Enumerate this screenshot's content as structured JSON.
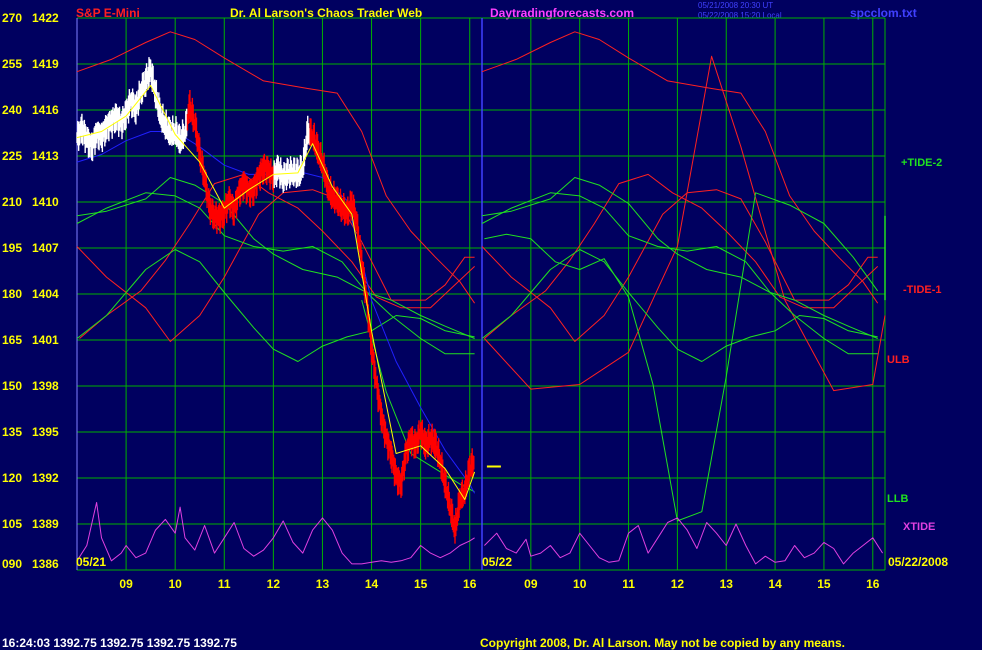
{
  "header": {
    "instrument": "S&P E-Mini",
    "title": "Dr. Al Larson's Chaos Trader Web",
    "site": "Daytradingforecasts.com",
    "timestamp_line1": "05/21/2008 20:30 UT",
    "timestamp_line2": "05/22/2008 15:20 Local",
    "filename": "spcclom.txt"
  },
  "footer": {
    "quote": "16:24:03  1392.75  1392.75  1392.75  1392.75",
    "copyright": "Copyright 2008, Dr. Al Larson. May not be copied by any means."
  },
  "colors": {
    "background": "#000060",
    "grid": "#00b000",
    "price_up": "#ffffff",
    "price_down": "#ff0000",
    "red_curves": "#ff2020",
    "green_curves": "#20e020",
    "blue_line": "#2020ff",
    "yellow_line": "#ffff00",
    "xtide": "#e040e0",
    "labels": "#ffff00",
    "site": "#ff40ff"
  },
  "chart_data": {
    "type": "line",
    "y_axis": {
      "ticks": [
        {
          "index": "270",
          "price": "1422"
        },
        {
          "index": "255",
          "price": "1419"
        },
        {
          "index": "240",
          "price": "1416"
        },
        {
          "index": "225",
          "price": "1413"
        },
        {
          "index": "210",
          "price": "1410"
        },
        {
          "index": "195",
          "price": "1407"
        },
        {
          "index": "180",
          "price": "1404"
        },
        {
          "index": "165",
          "price": "1401"
        },
        {
          "index": "150",
          "price": "1398"
        },
        {
          "index": "135",
          "price": "1395"
        },
        {
          "index": "120",
          "price": "1392"
        },
        {
          "index": "105",
          "price": "1389"
        },
        {
          "index": "090",
          "price": "1386"
        }
      ],
      "range": [
        1386,
        1422
      ]
    },
    "x_axis": {
      "day1_label": "05/21",
      "day2_label": "05/22",
      "date_right": "05/22/2008",
      "ticks_day1": [
        "09",
        "10",
        "11",
        "12",
        "13",
        "14",
        "15",
        "16"
      ],
      "ticks_day2": [
        "09",
        "10",
        "11",
        "12",
        "13",
        "14",
        "15",
        "16"
      ],
      "range_hours": [
        8.0,
        16.25
      ]
    },
    "series_labels": [
      {
        "name": "+TIDE-2",
        "color": "#20e020"
      },
      {
        "name": "-TIDE-1",
        "color": "#ff2020"
      },
      {
        "name": "ULB",
        "color": "#ff2020"
      },
      {
        "name": "LLB",
        "color": "#20e020"
      },
      {
        "name": "XTIDE",
        "color": "#e040e0"
      }
    ],
    "price_bars": [
      [
        8.0,
        1414.2
      ],
      [
        8.1,
        1414.8
      ],
      [
        8.2,
        1414.1
      ],
      [
        8.3,
        1413.6
      ],
      [
        8.4,
        1414.5
      ],
      [
        8.5,
        1414.3
      ],
      [
        8.6,
        1414.9
      ],
      [
        8.7,
        1415.2
      ],
      [
        8.8,
        1415.6
      ],
      [
        8.9,
        1415.1
      ],
      [
        9.0,
        1415.8
      ],
      [
        9.1,
        1416.6
      ],
      [
        9.2,
        1416.1
      ],
      [
        9.3,
        1417.2
      ],
      [
        9.4,
        1417.9
      ],
      [
        9.5,
        1418.6
      ],
      [
        9.6,
        1417.1
      ],
      [
        9.7,
        1415.6
      ],
      [
        9.8,
        1415.0
      ],
      [
        9.9,
        1414.4
      ],
      [
        10.0,
        1414.6
      ],
      [
        10.1,
        1413.9
      ],
      [
        10.2,
        1414.6
      ],
      [
        10.3,
        1416.2
      ],
      [
        10.4,
        1415.2
      ],
      [
        10.5,
        1413.1
      ],
      [
        10.6,
        1411.6
      ],
      [
        10.7,
        1409.6
      ],
      [
        10.8,
        1409.1
      ],
      [
        10.9,
        1408.9
      ],
      [
        11.0,
        1409.4
      ],
      [
        11.1,
        1410.1
      ],
      [
        11.2,
        1409.5
      ],
      [
        11.3,
        1410.6
      ],
      [
        11.4,
        1411.3
      ],
      [
        11.5,
        1410.6
      ],
      [
        11.6,
        1410.9
      ],
      [
        11.7,
        1411.6
      ],
      [
        11.8,
        1412.3
      ],
      [
        11.9,
        1412.0
      ],
      [
        12.0,
        1411.7
      ],
      [
        12.1,
        1412.1
      ],
      [
        12.2,
        1411.6
      ],
      [
        12.3,
        1411.8
      ],
      [
        12.4,
        1412.0
      ],
      [
        12.5,
        1411.7
      ],
      [
        12.6,
        1412.3
      ],
      [
        12.7,
        1414.5
      ],
      [
        12.8,
        1414.4
      ],
      [
        12.9,
        1413.3
      ],
      [
        13.0,
        1412.6
      ],
      [
        13.1,
        1411.0
      ],
      [
        13.2,
        1410.4
      ],
      [
        13.3,
        1410.0
      ],
      [
        13.4,
        1409.7
      ],
      [
        13.5,
        1409.2
      ],
      [
        13.6,
        1410.0
      ],
      [
        13.7,
        1408.6
      ],
      [
        13.8,
        1406.1
      ],
      [
        13.9,
        1403.6
      ],
      [
        14.0,
        1400.6
      ],
      [
        14.1,
        1398.1
      ],
      [
        14.2,
        1396.1
      ],
      [
        14.3,
        1394.6
      ],
      [
        14.4,
        1393.6
      ],
      [
        14.5,
        1392.1
      ],
      [
        14.6,
        1391.6
      ],
      [
        14.7,
        1393.6
      ],
      [
        14.8,
        1394.6
      ],
      [
        14.9,
        1394.1
      ],
      [
        15.0,
        1395.1
      ],
      [
        15.1,
        1394.1
      ],
      [
        15.2,
        1394.6
      ],
      [
        15.3,
        1394.2
      ],
      [
        15.4,
        1393.1
      ],
      [
        15.5,
        1391.6
      ],
      [
        15.6,
        1390.1
      ],
      [
        15.7,
        1388.6
      ],
      [
        15.8,
        1390.6
      ],
      [
        15.9,
        1391.1
      ],
      [
        16.0,
        1392.6
      ],
      [
        16.1,
        1393.1
      ]
    ],
    "projection_mark": {
      "hour": 16.35,
      "price": 1392.75
    },
    "red_curves": [
      [
        [
          8.0,
          1418.5
        ],
        [
          8.7,
          1419.3
        ],
        [
          9.4,
          1420.4
        ],
        [
          9.9,
          1421.1
        ],
        [
          10.4,
          1420.6
        ],
        [
          11.0,
          1419.4
        ],
        [
          11.8,
          1417.9
        ],
        [
          12.7,
          1417.4
        ],
        [
          13.3,
          1417.1
        ],
        [
          13.8,
          1414.6
        ],
        [
          14.3,
          1410.4
        ],
        [
          14.8,
          1408.1
        ],
        [
          15.3,
          1406.4
        ],
        [
          15.8,
          1404.8
        ],
        [
          16.1,
          1403.4
        ]
      ],
      [
        [
          8.0,
          1407.1
        ],
        [
          8.6,
          1405.1
        ],
        [
          9.4,
          1403.1
        ],
        [
          9.9,
          1400.9
        ],
        [
          10.5,
          1402.6
        ],
        [
          11.0,
          1405.1
        ],
        [
          11.7,
          1409.2
        ],
        [
          12.2,
          1410.6
        ],
        [
          12.8,
          1410.8
        ],
        [
          13.3,
          1410.2
        ],
        [
          13.8,
          1407.4
        ],
        [
          14.4,
          1403.6
        ],
        [
          15.1,
          1403.6
        ],
        [
          15.5,
          1404.6
        ],
        [
          15.9,
          1406.4
        ],
        [
          16.1,
          1406.4
        ]
      ],
      [
        [
          8.05,
          1401.1
        ],
        [
          8.6,
          1402.6
        ],
        [
          9.3,
          1404.2
        ],
        [
          9.8,
          1406.2
        ],
        [
          10.3,
          1408.6
        ],
        [
          10.8,
          1411.2
        ],
        [
          11.4,
          1411.8
        ],
        [
          11.9,
          1410.6
        ],
        [
          12.5,
          1409.6
        ],
        [
          13.0,
          1408.1
        ],
        [
          13.6,
          1406.1
        ],
        [
          14.1,
          1403.8
        ],
        [
          14.6,
          1403.1
        ],
        [
          15.2,
          1403.1
        ],
        [
          15.7,
          1404.6
        ],
        [
          16.1,
          1405.8
        ]
      ],
      [
        [
          8.05,
          1401.1
        ],
        [
          9.0,
          1397.8
        ],
        [
          10.0,
          1398.1
        ],
        [
          11.0,
          1400.2
        ],
        [
          12.0,
          1407.1
        ],
        [
          12.7,
          1419.5
        ],
        [
          13.3,
          1413.6
        ],
        [
          14.2,
          1403.6
        ],
        [
          15.2,
          1397.7
        ],
        [
          16.0,
          1398.1
        ],
        [
          16.25,
          1402.6
        ]
      ]
    ],
    "green_curves": [
      [
        [
          8.0,
          1401.1
        ],
        [
          8.6,
          1402.6
        ],
        [
          9.4,
          1405.6
        ],
        [
          10.0,
          1406.9
        ],
        [
          10.5,
          1406.1
        ],
        [
          11.0,
          1404.1
        ],
        [
          11.6,
          1401.8
        ],
        [
          12.0,
          1400.4
        ],
        [
          12.5,
          1399.6
        ],
        [
          13.0,
          1400.6
        ],
        [
          13.5,
          1401.2
        ],
        [
          14.0,
          1401.6
        ],
        [
          14.5,
          1402.6
        ],
        [
          15.0,
          1402.4
        ],
        [
          15.5,
          1401.6
        ],
        [
          16.1,
          1401.2
        ]
      ],
      [
        [
          8.0,
          1408.6
        ],
        [
          8.6,
          1409.6
        ],
        [
          9.4,
          1410.6
        ],
        [
          10.0,
          1410.4
        ],
        [
          10.5,
          1409.6
        ],
        [
          11.0,
          1407.8
        ],
        [
          11.6,
          1407.1
        ],
        [
          12.2,
          1406.8
        ],
        [
          12.8,
          1407.1
        ],
        [
          13.4,
          1406.1
        ],
        [
          13.9,
          1404.1
        ],
        [
          14.4,
          1403.6
        ],
        [
          15.0,
          1402.6
        ],
        [
          15.5,
          1401.9
        ],
        [
          16.1,
          1401.1
        ]
      ],
      [
        [
          8.0,
          1409.1
        ],
        [
          8.6,
          1409.4
        ],
        [
          9.4,
          1410.2
        ],
        [
          9.9,
          1411.6
        ],
        [
          10.4,
          1411.1
        ],
        [
          11.0,
          1409.9
        ],
        [
          11.6,
          1407.6
        ],
        [
          12.0,
          1406.6
        ],
        [
          12.6,
          1405.6
        ],
        [
          13.3,
          1405.1
        ],
        [
          13.9,
          1404.1
        ],
        [
          14.4,
          1402.6
        ],
        [
          15.0,
          1401.1
        ],
        [
          15.5,
          1400.1
        ],
        [
          16.1,
          1400.1
        ]
      ],
      [
        [
          8.05,
          1407.6
        ],
        [
          8.5,
          1407.9
        ],
        [
          9.0,
          1407.6
        ],
        [
          9.5,
          1406.1
        ],
        [
          10.0,
          1405.6
        ],
        [
          10.5,
          1406.3
        ],
        [
          11.0,
          1403.8
        ],
        [
          11.5,
          1398.1
        ],
        [
          12.0,
          1389.2
        ],
        [
          12.5,
          1389.8
        ],
        [
          13.0,
          1398.6
        ],
        [
          13.6,
          1410.6
        ],
        [
          14.3,
          1409.8
        ],
        [
          15.0,
          1408.6
        ],
        [
          15.6,
          1406.4
        ],
        [
          16.1,
          1404.2
        ]
      ],
      [
        [
          13.8,
          1403.6
        ],
        [
          14.3,
          1397.6
        ],
        [
          14.8,
          1393.6
        ],
        [
          15.3,
          1392.6
        ],
        [
          15.8,
          1391.6
        ],
        [
          16.1,
          1391.1
        ]
      ]
    ],
    "blue_line": [
      [
        8.0,
        1412.6
      ],
      [
        8.5,
        1413.1
      ],
      [
        9.0,
        1414.0
      ],
      [
        9.5,
        1414.6
      ],
      [
        10.0,
        1414.6
      ],
      [
        10.5,
        1413.6
      ],
      [
        11.0,
        1412.4
      ],
      [
        11.5,
        1411.8
      ],
      [
        12.0,
        1411.8
      ],
      [
        12.5,
        1412.0
      ],
      [
        13.0,
        1411.6
      ],
      [
        13.5,
        1410.1
      ],
      [
        14.0,
        1403.6
      ],
      [
        14.5,
        1399.6
      ],
      [
        15.0,
        1396.6
      ],
      [
        15.5,
        1393.8
      ],
      [
        16.0,
        1391.6
      ],
      [
        16.1,
        1391.0
      ]
    ],
    "yellow_line": [
      [
        8.0,
        1414.2
      ],
      [
        8.5,
        1414.6
      ],
      [
        9.0,
        1415.6
      ],
      [
        9.5,
        1417.6
      ],
      [
        10.0,
        1414.4
      ],
      [
        10.5,
        1412.6
      ],
      [
        11.0,
        1409.6
      ],
      [
        11.5,
        1410.8
      ],
      [
        12.0,
        1411.8
      ],
      [
        12.5,
        1411.9
      ],
      [
        12.8,
        1413.8
      ],
      [
        13.2,
        1411.0
      ],
      [
        13.6,
        1409.2
      ],
      [
        14.0,
        1401.6
      ],
      [
        14.5,
        1393.6
      ],
      [
        15.0,
        1394.1
      ],
      [
        15.5,
        1392.6
      ],
      [
        15.9,
        1390.6
      ],
      [
        16.1,
        1392.4
      ]
    ],
    "xtide_day1": [
      [
        8.0,
        1386.6
      ],
      [
        8.2,
        1387.6
      ],
      [
        8.4,
        1390.4
      ],
      [
        8.5,
        1388.1
      ],
      [
        8.7,
        1386.6
      ],
      [
        8.9,
        1387.1
      ],
      [
        9.0,
        1387.6
      ],
      [
        9.2,
        1386.8
      ],
      [
        9.4,
        1387.1
      ],
      [
        9.6,
        1388.6
      ],
      [
        9.8,
        1389.3
      ],
      [
        10.0,
        1388.4
      ],
      [
        10.1,
        1390.1
      ],
      [
        10.2,
        1388.1
      ],
      [
        10.4,
        1387.3
      ],
      [
        10.6,
        1388.9
      ],
      [
        10.8,
        1387.1
      ],
      [
        11.0,
        1388.1
      ],
      [
        11.2,
        1389.1
      ],
      [
        11.4,
        1387.4
      ],
      [
        11.6,
        1386.9
      ],
      [
        11.8,
        1387.3
      ],
      [
        12.0,
        1388.1
      ],
      [
        12.2,
        1389.2
      ],
      [
        12.4,
        1387.8
      ],
      [
        12.6,
        1387.1
      ],
      [
        12.8,
        1388.6
      ],
      [
        13.0,
        1389.4
      ],
      [
        13.2,
        1388.6
      ],
      [
        13.4,
        1387.1
      ],
      [
        13.6,
        1386.4
      ],
      [
        13.8,
        1386.4
      ],
      [
        14.0,
        1386.5
      ],
      [
        14.2,
        1386.6
      ],
      [
        14.4,
        1386.5
      ],
      [
        14.6,
        1386.6
      ],
      [
        14.8,
        1386.8
      ],
      [
        15.0,
        1387.6
      ],
      [
        15.2,
        1387.1
      ],
      [
        15.4,
        1386.8
      ],
      [
        15.6,
        1387.1
      ],
      [
        15.8,
        1387.6
      ],
      [
        16.0,
        1387.9
      ],
      [
        16.1,
        1388.1
      ]
    ],
    "xtide_day2": [
      [
        8.05,
        1387.6
      ],
      [
        8.3,
        1388.4
      ],
      [
        8.5,
        1387.4
      ],
      [
        8.7,
        1387.1
      ],
      [
        8.9,
        1388.0
      ],
      [
        9.0,
        1386.9
      ],
      [
        9.2,
        1387.1
      ],
      [
        9.4,
        1387.6
      ],
      [
        9.6,
        1386.8
      ],
      [
        9.8,
        1387.1
      ],
      [
        10.0,
        1388.4
      ],
      [
        10.2,
        1387.6
      ],
      [
        10.4,
        1386.8
      ],
      [
        10.6,
        1386.5
      ],
      [
        10.8,
        1386.6
      ],
      [
        11.0,
        1388.4
      ],
      [
        11.2,
        1388.9
      ],
      [
        11.4,
        1387.1
      ],
      [
        11.6,
        1388.1
      ],
      [
        11.8,
        1389.1
      ],
      [
        12.0,
        1389.4
      ],
      [
        12.2,
        1388.6
      ],
      [
        12.4,
        1387.4
      ],
      [
        12.6,
        1389.1
      ],
      [
        12.8,
        1388.4
      ],
      [
        13.0,
        1387.6
      ],
      [
        13.2,
        1389.0
      ],
      [
        13.4,
        1387.6
      ],
      [
        13.6,
        1386.4
      ],
      [
        13.8,
        1386.9
      ],
      [
        14.0,
        1386.5
      ],
      [
        14.2,
        1386.6
      ],
      [
        14.4,
        1387.6
      ],
      [
        14.6,
        1386.8
      ],
      [
        14.8,
        1387.1
      ],
      [
        15.0,
        1387.8
      ],
      [
        15.2,
        1387.4
      ],
      [
        15.4,
        1386.4
      ],
      [
        15.6,
        1387.1
      ],
      [
        15.8,
        1387.6
      ],
      [
        16.0,
        1388.1
      ],
      [
        16.2,
        1387.1
      ]
    ]
  }
}
